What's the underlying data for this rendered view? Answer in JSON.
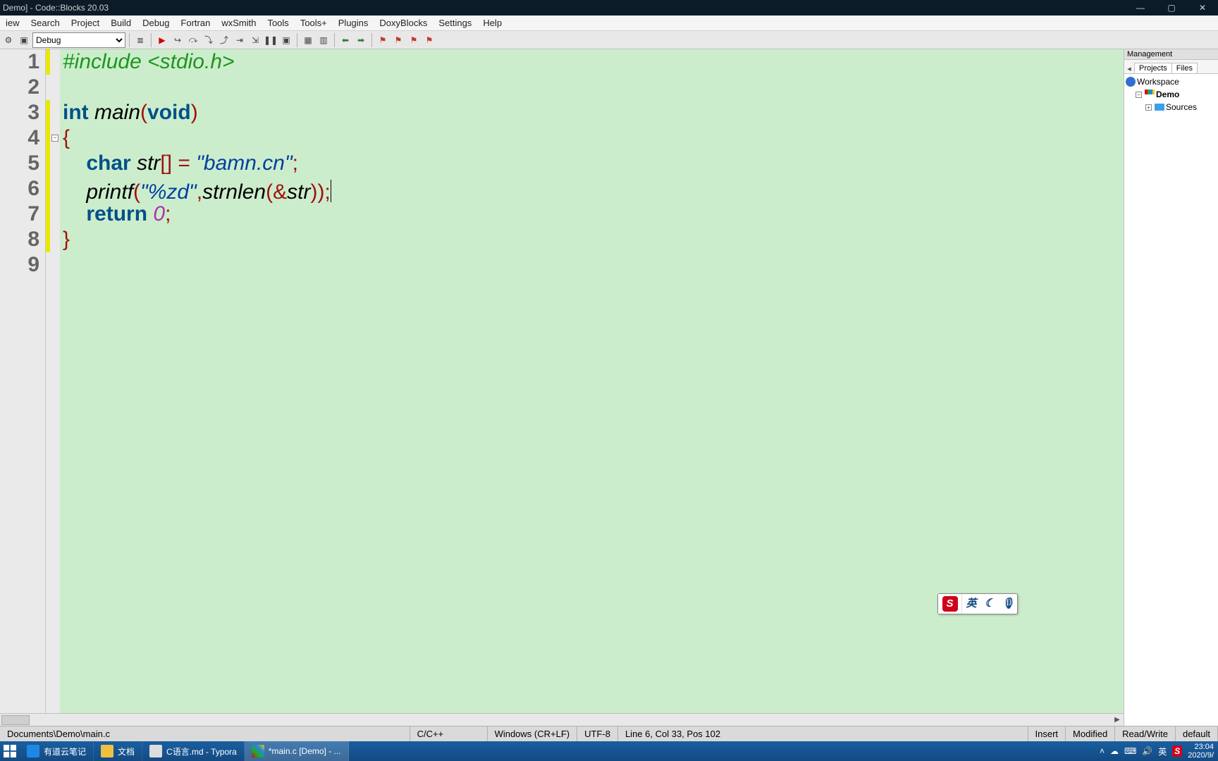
{
  "title": "Demo] - Code::Blocks 20.03",
  "menu": [
    "iew",
    "Search",
    "Project",
    "Build",
    "Debug",
    "Fortran",
    "wxSmith",
    "Tools",
    "Tools+",
    "Plugins",
    "DoxyBlocks",
    "Settings",
    "Help"
  ],
  "toolbar": {
    "config": "Debug"
  },
  "gutter": [
    "1",
    "2",
    "3",
    "4",
    "5",
    "6",
    "7",
    "8",
    "9"
  ],
  "code": {
    "l1": {
      "pre1": "#include ",
      "pre2": "<stdio.h>"
    },
    "l3": {
      "kw1": "int",
      "sp1": " ",
      "id1": "main",
      "p1": "(",
      "kw2": "void",
      "p2": ")"
    },
    "l4": {
      "p1": "{"
    },
    "l5": {
      "indent": "    ",
      "kw": "char",
      "sp": " ",
      "id": "str",
      "br": "[] ",
      "eq": "= ",
      "str": "\"bamn.cn\"",
      "semi": ";"
    },
    "l6": {
      "indent": "    ",
      "id": "printf",
      "p1": "(",
      "s1": "\"%zd\"",
      "comma": ",",
      "id2": "strnlen",
      "p2": "(",
      "amp": "&",
      "id3": "str",
      "p3": ")",
      "p4": ")",
      "semi": ";"
    },
    "l7": {
      "indent": "    ",
      "kw": "return",
      "sp": " ",
      "num": "0",
      "semi": ";"
    },
    "l8": {
      "p1": "}"
    }
  },
  "mgmt": {
    "title": "Management",
    "tabs": [
      "Projects",
      "Files"
    ],
    "workspace": "Workspace",
    "project": "Demo",
    "folder": "Sources"
  },
  "status": {
    "path": "Documents\\Demo\\main.c",
    "lang": "C/C++",
    "eol": "Windows (CR+LF)",
    "enc": "UTF-8",
    "pos": "Line 6, Col 33, Pos 102",
    "ins": "Insert",
    "mod": "Modified",
    "rw": "Read/Write",
    "def": "default"
  },
  "taskbar": {
    "items": [
      {
        "label": "有道云笔记"
      },
      {
        "label": "文档"
      },
      {
        "label": "C语言.md - Typora"
      },
      {
        "label": "*main.c [Demo] - ..."
      }
    ],
    "ime_lang": "英",
    "tray_lang": "英",
    "clock_time": "23:04",
    "clock_date": "2020/9/"
  },
  "ime": {
    "lang": "英"
  }
}
